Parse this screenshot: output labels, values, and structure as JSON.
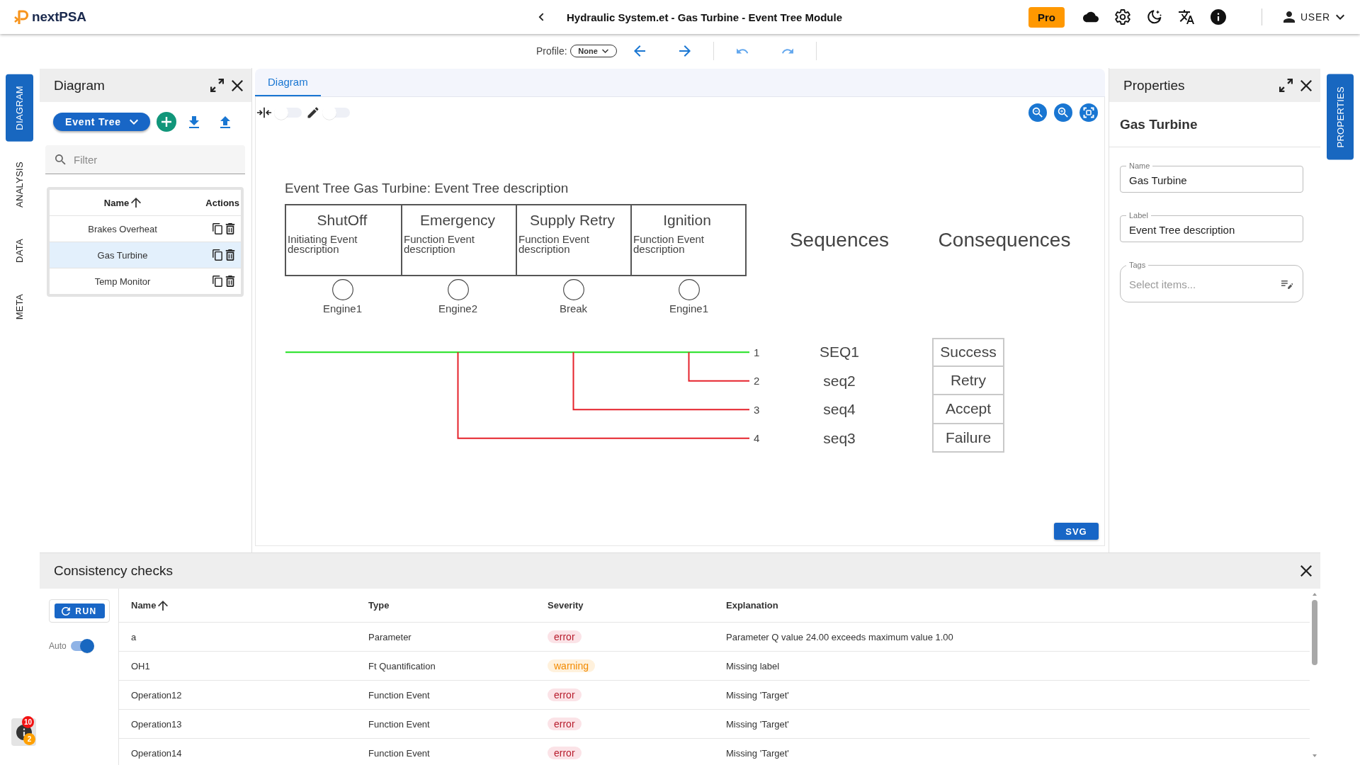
{
  "app_bar": {
    "logo_text": "nextPSA",
    "title": "Hydraulic System.et - Gas Turbine - Event Tree Module",
    "plan_button": "Pro",
    "user_menu": "USER"
  },
  "toolbar": {
    "profile_label": "Profile:",
    "profile_value": "None"
  },
  "left_rail": [
    {
      "label": "DIAGRAM",
      "selected": true
    },
    {
      "label": "ANALYSIS",
      "selected": false
    },
    {
      "label": "DATA",
      "selected": false
    },
    {
      "label": "META",
      "selected": false
    }
  ],
  "diagram_panel": {
    "title": "Diagram",
    "type_menu": "Event Tree",
    "filter": {
      "placeholder": "Filter"
    },
    "columns": [
      {
        "label": "Name",
        "sorted": true
      },
      {
        "label": "Actions",
        "sorted": false
      }
    ],
    "rows": [
      {
        "name": "Brakes Overheat",
        "selected": false
      },
      {
        "name": "Gas Turbine",
        "selected": true
      },
      {
        "name": "Temp Monitor",
        "selected": false
      }
    ]
  },
  "editor": {
    "tabs": [
      {
        "label": "Diagram",
        "selected": true
      }
    ],
    "toggles": [
      {
        "kind": "compress",
        "on": false
      },
      {
        "kind": "edit",
        "on": false
      }
    ],
    "event_tree": {
      "title": "Event Tree Gas Turbine: Event Tree description",
      "events": [
        {
          "name": "ShutOff",
          "description": "Initiating Event description",
          "branch_label": "Engine1",
          "branches": false
        },
        {
          "name": "Emergency",
          "description": "Function Event description",
          "branch_label": "Engine2",
          "branches": true
        },
        {
          "name": "Supply Retry",
          "description": "Function Event description",
          "branch_label": "Break",
          "branches": true
        },
        {
          "name": "Ignition",
          "description": "Function Event description",
          "branch_label": "Engine1",
          "branches": true
        }
      ],
      "sequences_heading": "Sequences",
      "consequences_heading": "Consequences",
      "sequences": [
        {
          "number": "1",
          "name": "SEQ1",
          "consequence": "Success"
        },
        {
          "number": "2",
          "name": "seq2",
          "consequence": "Retry"
        },
        {
          "number": "3",
          "name": "seq4",
          "consequence": "Accept"
        },
        {
          "number": "4",
          "name": "seq3",
          "consequence": "Failure"
        }
      ]
    },
    "export_button": "SVG"
  },
  "properties": {
    "title": "Properties",
    "heading": "Gas Turbine",
    "fields": [
      {
        "kind": "text",
        "label": "Name",
        "value": "Gas Turbine"
      },
      {
        "kind": "text",
        "label": "Label",
        "value": "Event Tree description"
      },
      {
        "kind": "select",
        "label": "Tags",
        "placeholder": "Select items..."
      }
    ]
  },
  "right_rail": [
    {
      "label": "PROPERTIES",
      "selected": true
    }
  ],
  "consistency_checks": {
    "title": "Consistency checks",
    "run_button": "RUN",
    "auto": {
      "label": "Auto",
      "on": true
    },
    "columns": [
      {
        "label": "Name",
        "sorted": true
      },
      {
        "label": "Type",
        "sorted": false
      },
      {
        "label": "Severity",
        "sorted": false
      },
      {
        "label": "Explanation",
        "sorted": false
      }
    ],
    "rows": [
      {
        "name": "a",
        "type": "Parameter",
        "kind": "error",
        "severity": "error",
        "explanation": "Parameter Q value 24.00 exceeds maximum value 1.00"
      },
      {
        "name": "OH1",
        "type": "Ft Quantification",
        "kind": "warning",
        "severity": "warning",
        "explanation": "Missing label"
      },
      {
        "name": "Operation12",
        "type": "Function Event",
        "kind": "error",
        "severity": "error",
        "explanation": "Missing 'Target'"
      },
      {
        "name": "Operation13",
        "type": "Function Event",
        "kind": "error",
        "severity": "error",
        "explanation": "Missing 'Target'"
      },
      {
        "name": "Operation14",
        "type": "Function Event",
        "kind": "error",
        "severity": "error",
        "explanation": "Missing 'Target'"
      }
    ]
  },
  "notifications": {
    "error_count": "10",
    "warning_count": "2"
  }
}
